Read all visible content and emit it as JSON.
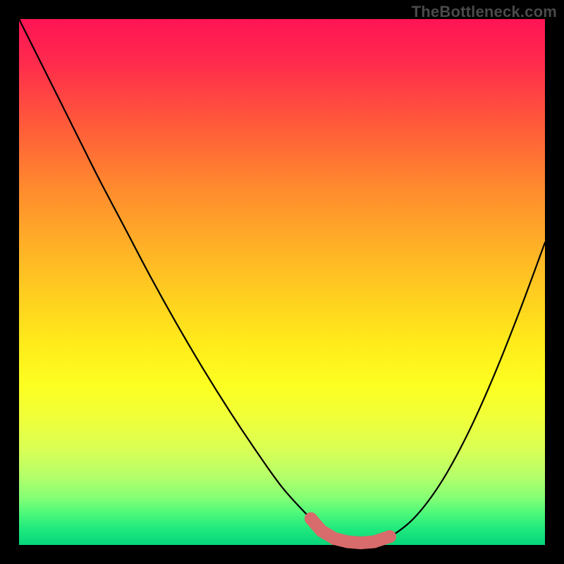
{
  "watermark": "TheBottleneck.com",
  "colors": {
    "frame_bg": "#000000",
    "gradient_top": "#ff1455",
    "gradient_bottom": "#06d47a",
    "curve_stroke": "#000000",
    "marker_fill": "#d86b6b",
    "marker_stroke": "#b94f4f"
  },
  "chart_data": {
    "type": "line",
    "title": "",
    "xlabel": "",
    "ylabel": "",
    "x": [
      0.0,
      0.05,
      0.1,
      0.15,
      0.2,
      0.25,
      0.3,
      0.35,
      0.4,
      0.45,
      0.5,
      0.55,
      0.575,
      0.6,
      0.625,
      0.65,
      0.675,
      0.7,
      0.75,
      0.8,
      0.85,
      0.9,
      0.95,
      1.0
    ],
    "values": [
      1.0,
      0.9,
      0.8,
      0.7,
      0.605,
      0.51,
      0.42,
      0.335,
      0.255,
      0.18,
      0.11,
      0.055,
      0.033,
      0.017,
      0.008,
      0.004,
      0.005,
      0.012,
      0.05,
      0.115,
      0.205,
      0.315,
      0.44,
      0.575
    ],
    "xlim": [
      0,
      1
    ],
    "ylim": [
      0,
      1
    ],
    "markers": {
      "x": [
        0.555,
        0.575,
        0.6,
        0.625,
        0.65,
        0.675,
        0.705
      ],
      "y": [
        0.05,
        0.027,
        0.012,
        0.006,
        0.004,
        0.006,
        0.016
      ]
    },
    "annotations": []
  }
}
